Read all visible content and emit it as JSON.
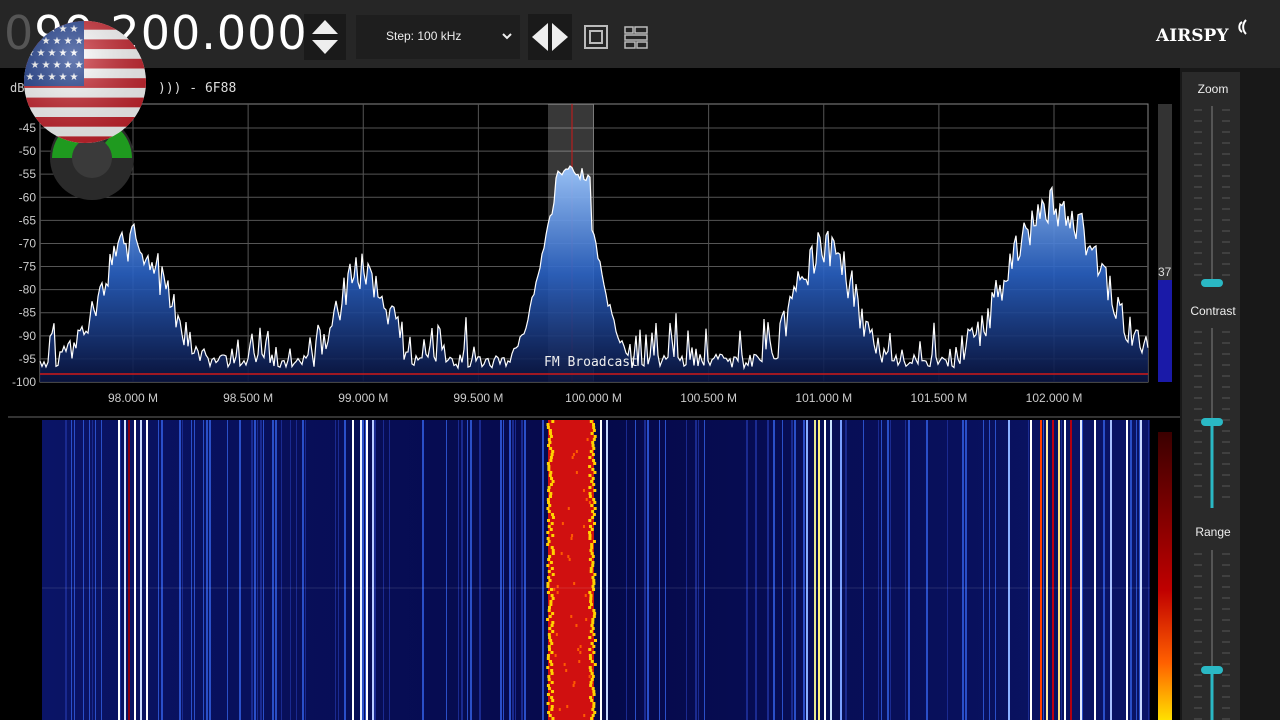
{
  "toolbar": {
    "freq_dim": "0",
    "freq_main": "99.200.000",
    "step_label": "Step: 100 kHz",
    "logo_text": "AIRSPY"
  },
  "spectrum": {
    "db_label": "dB",
    "info_text": "))) - 6F88",
    "y_ticks": [
      "-45",
      "-50",
      "-55",
      "-60",
      "-65",
      "-70",
      "-75",
      "-80",
      "-85",
      "-90",
      "-95",
      "-100"
    ],
    "x_ticks": [
      "98.000 M",
      "98.500 M",
      "99.000 M",
      "99.500 M",
      "100.000 M",
      "100.500 M",
      "101.000 M",
      "101.500 M",
      "102.000 M"
    ],
    "band_label": "FM Broadcast",
    "level_value": "37"
  },
  "side": {
    "zoom_label": "Zoom",
    "contrast_label": "Contrast",
    "range_label": "Range"
  },
  "colors": {
    "accent": "#2ab8c4",
    "spectrum_line": "#ffffff",
    "baseline": "#d01818",
    "grid": "#777777",
    "waterfall_bg": "#05094a"
  },
  "icons": [
    "chevron-up-icon",
    "chevron-down-icon",
    "dropdown-chevron-icon",
    "arrow-left-icon",
    "arrow-right-icon",
    "fullscreen-icon",
    "layout-icon",
    "usa-flag-icon"
  ]
}
